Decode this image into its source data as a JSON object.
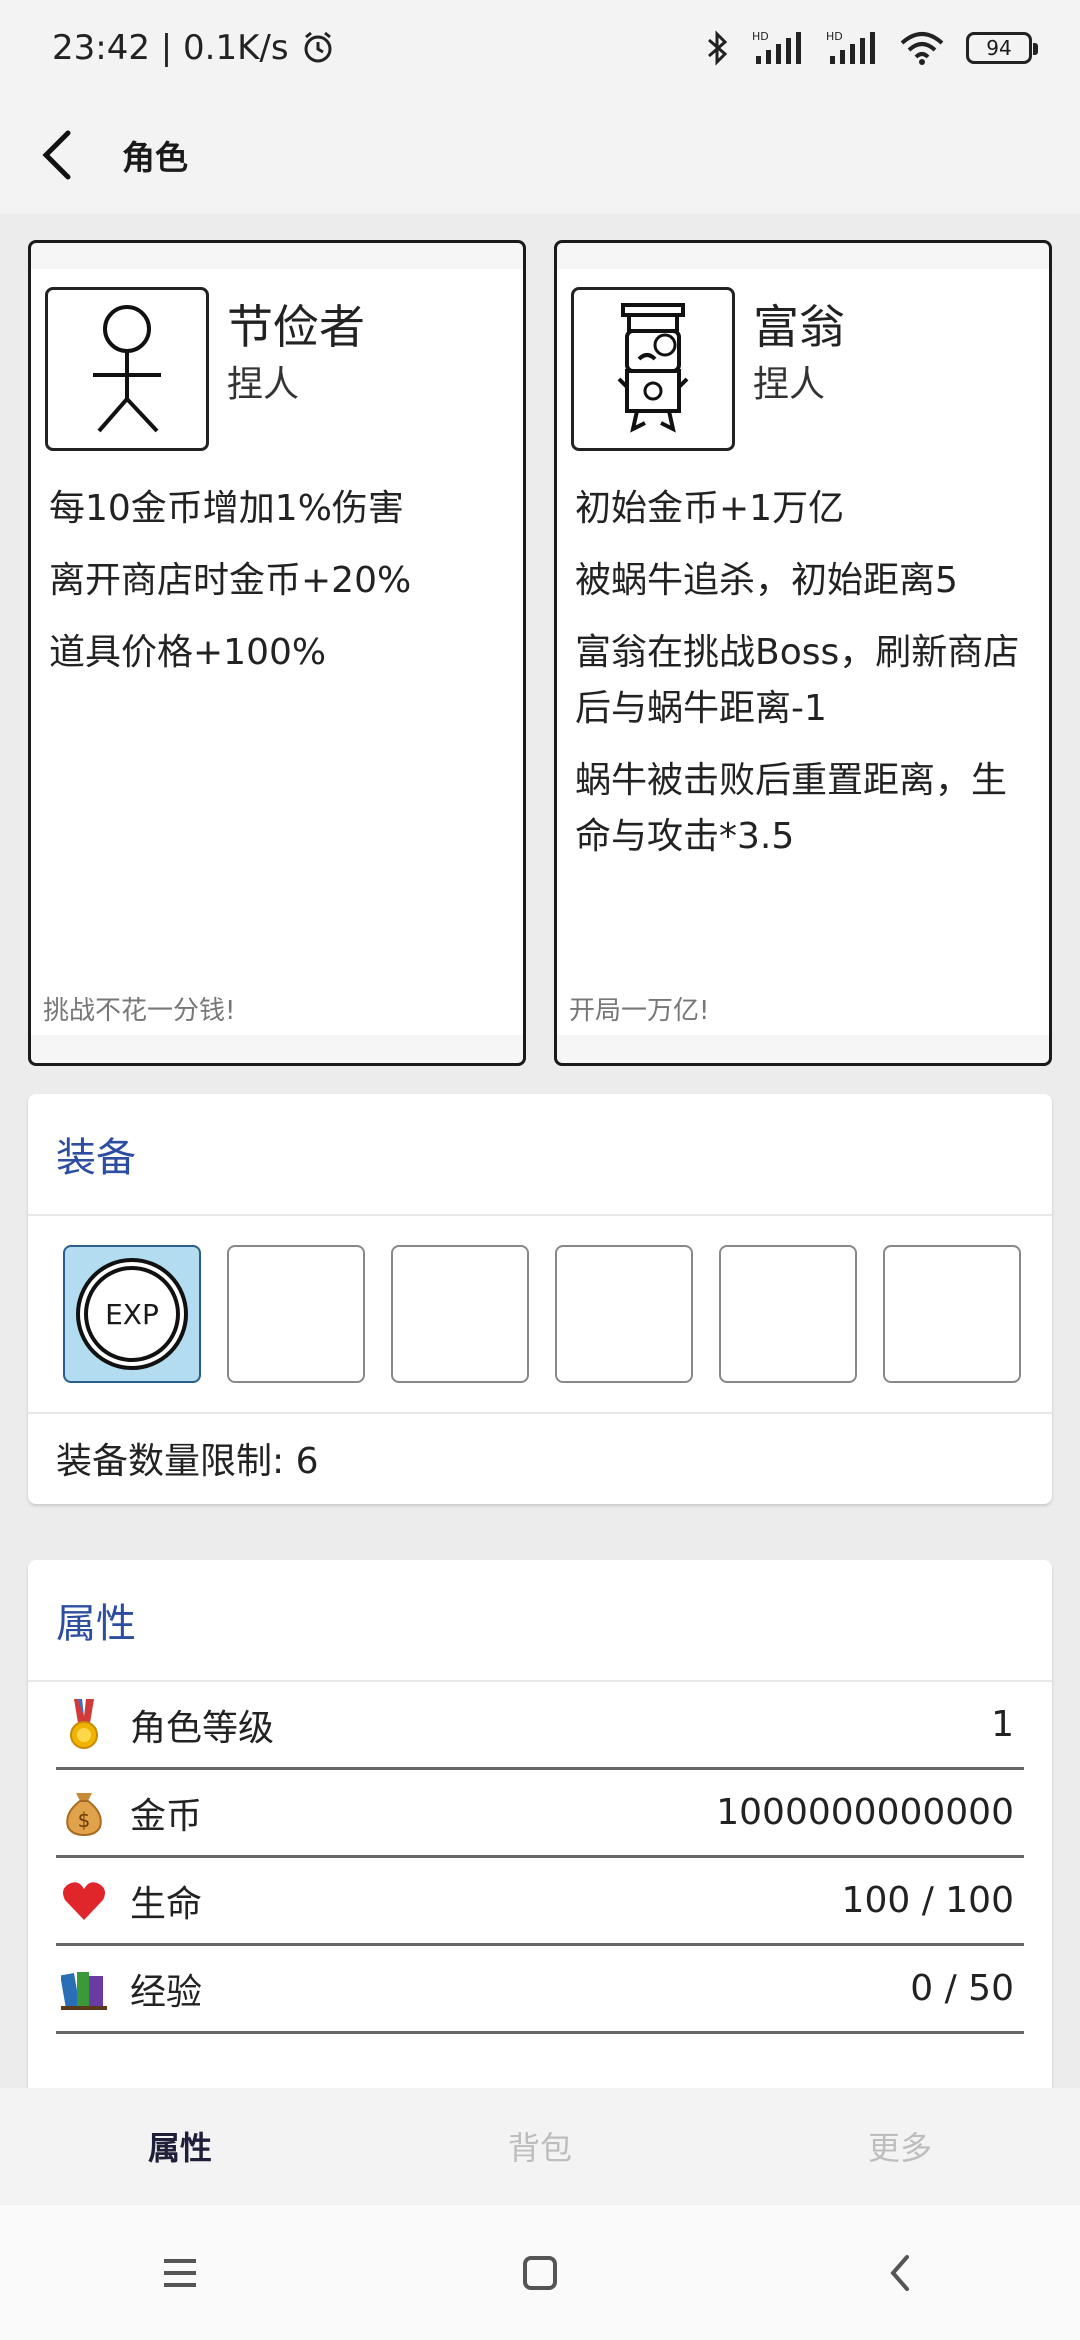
{
  "status_bar": {
    "time_speed": "23:42 | 0.1K/s",
    "battery": "94",
    "network_badges": [
      "HD",
      "HD"
    ]
  },
  "appbar": {
    "title": "角色"
  },
  "characters": [
    {
      "name": "节俭者",
      "type": "捏人",
      "avatar_icon": "stick-figure-icon",
      "effects": [
        "每10金币增加1%伤害",
        "离开商店时金币+20%",
        "道具价格+100%"
      ],
      "quote": "挑战不花一分钱!"
    },
    {
      "name": "富翁",
      "type": "捏人",
      "avatar_icon": "rich-man-icon",
      "effects": [
        "初始金币+1万亿",
        "被蜗牛追杀，初始距离5",
        "富翁在挑战Boss，刷新商店后与蜗牛距离-1",
        "蜗牛被击败后重置距离，生命与攻击*3.5"
      ],
      "quote": "开局一万亿!"
    }
  ],
  "equipment": {
    "title": "装备",
    "slots": [
      {
        "filled": true,
        "label": "EXP"
      },
      {
        "filled": false
      },
      {
        "filled": false
      },
      {
        "filled": false
      },
      {
        "filled": false
      },
      {
        "filled": false
      }
    ],
    "limit_text": "装备数量限制: 6"
  },
  "attributes": {
    "title": "属性",
    "rows": [
      {
        "icon": "medal-icon",
        "label": "角色等级",
        "value": "1"
      },
      {
        "icon": "money-bag-icon",
        "label": "金币",
        "value": "1000000000000"
      },
      {
        "icon": "heart-icon",
        "label": "生命",
        "value": "100 / 100"
      },
      {
        "icon": "books-icon",
        "label": "经验",
        "value": "0 / 50"
      }
    ]
  },
  "tabs": [
    {
      "label": "属性",
      "active": true
    },
    {
      "label": "背包",
      "active": false
    },
    {
      "label": "更多",
      "active": false
    }
  ],
  "colors": {
    "accent": "#2d4da0",
    "slot_active_bg": "#b3dcf0"
  }
}
